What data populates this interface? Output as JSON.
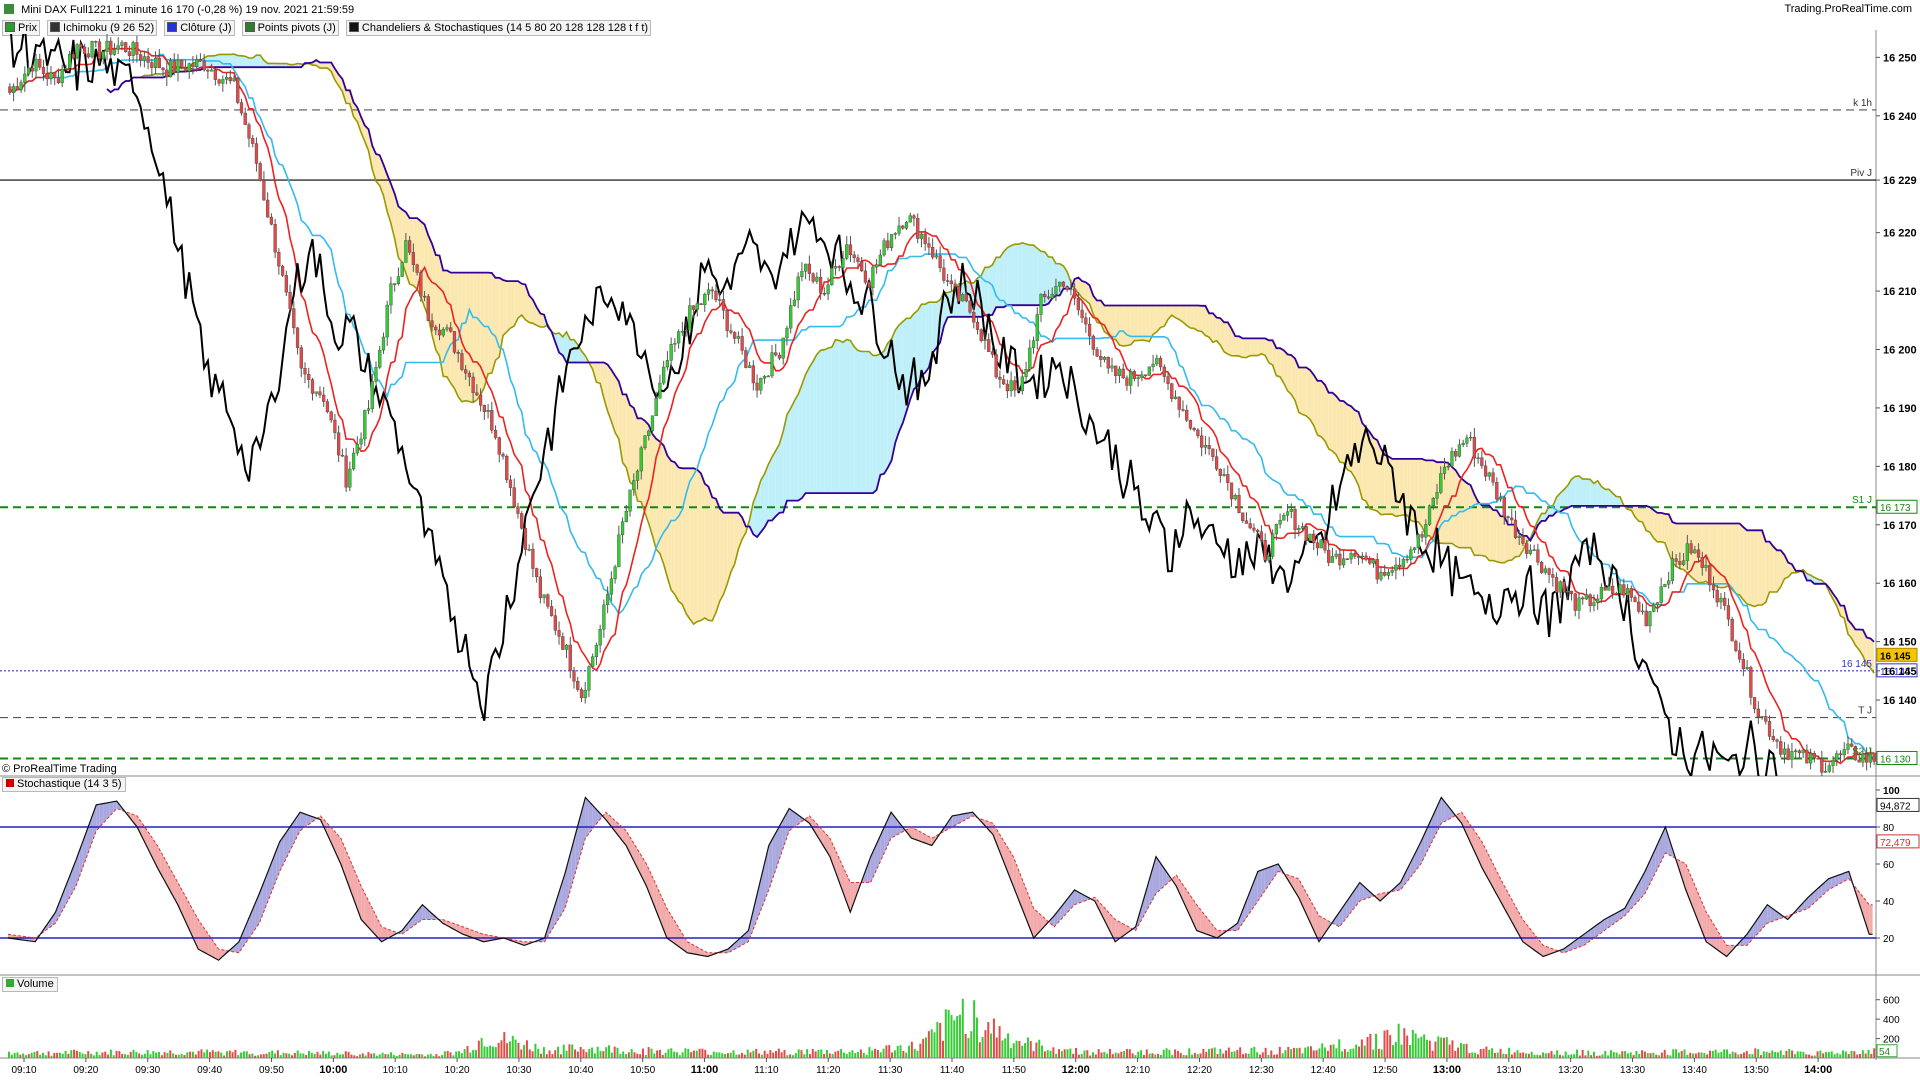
{
  "header": {
    "title": "Mini DAX Full1221 1 minute 16 170 (-0,28 %) 19 nov. 2021 21:59:59",
    "brand": "Trading.ProRealTime.com",
    "legend": [
      {
        "label": "Prix",
        "color": "#2e9b2e"
      },
      {
        "label": "Ichimoku (9 26 52)",
        "color": "#333333"
      },
      {
        "label": "Clôture (J)",
        "color": "#2233dd"
      },
      {
        "label": "Points pivots (J)",
        "color": "#2e7d32"
      },
      {
        "label": "Chandeliers & Stochastiques (14 5 80 20 128 128 128 t f t)",
        "color": "#111111"
      }
    ]
  },
  "panels": {
    "price_footer": "© ProRealTime Trading",
    "stochastic_label": "Stochastique (14 3 5)",
    "volume_label": "Volume"
  },
  "colors": {
    "up": "#33cc33",
    "down": "#e24a4a",
    "tenkan": "#ee2222",
    "kijun": "#33bbee",
    "span_a": "#999900",
    "span_b": "#330099",
    "cloud_bull": "#bfeff8",
    "cloud_bear": "#fbe8b0",
    "stoch_k": "#111111",
    "stoch_d": "#dd3333"
  },
  "chart_data": [
    {
      "type": "candlestick",
      "name": "Prix",
      "x_tick_labels": [
        "09:10",
        "09:20",
        "09:30",
        "09:40",
        "09:50",
        "10:00",
        "10:10",
        "10:20",
        "10:30",
        "10:40",
        "10:50",
        "11:00",
        "11:10",
        "11:20",
        "11:30",
        "11:40",
        "11:50",
        "12:00",
        "12:10",
        "12:20",
        "12:30",
        "12:40",
        "12:50",
        "13:00",
        "13:10",
        "13:20",
        "13:30",
        "13:40",
        "13:50",
        "14:00"
      ],
      "x_tick_bold": [
        "10:00",
        "11:00",
        "12:00",
        "13:00",
        "14:00"
      ],
      "ylim": [
        16127,
        16254
      ],
      "y_ticks": [
        16250,
        16240,
        16229,
        16220,
        16210,
        16200,
        16190,
        16180,
        16170,
        16160,
        16150,
        16145,
        16140
      ],
      "y_tick_labels": [
        "16 250",
        "16 240",
        "16 229",
        "16 220",
        "16 210",
        "16 200",
        "16 190",
        "16 180",
        "16 170",
        "16 160",
        "16 150",
        "16 145",
        "16 140"
      ],
      "close_anchors": [
        [
          0,
          16244
        ],
        [
          6,
          16249
        ],
        [
          12,
          16246
        ],
        [
          18,
          16252
        ],
        [
          24,
          16251
        ],
        [
          30,
          16252
        ],
        [
          36,
          16250
        ],
        [
          42,
          16248
        ],
        [
          52,
          16249
        ],
        [
          60,
          16245
        ],
        [
          66,
          16232
        ],
        [
          72,
          16215
        ],
        [
          78,
          16196
        ],
        [
          84,
          16192
        ],
        [
          90,
          16178
        ],
        [
          96,
          16190
        ],
        [
          102,
          16210
        ],
        [
          106,
          16218
        ],
        [
          112,
          16206
        ],
        [
          118,
          16202
        ],
        [
          124,
          16194
        ],
        [
          130,
          16186
        ],
        [
          136,
          16172
        ],
        [
          142,
          16158
        ],
        [
          148,
          16150
        ],
        [
          153,
          16141
        ],
        [
          158,
          16152
        ],
        [
          164,
          16170
        ],
        [
          170,
          16184
        ],
        [
          176,
          16198
        ],
        [
          182,
          16206
        ],
        [
          188,
          16210
        ],
        [
          194,
          16202
        ],
        [
          200,
          16194
        ],
        [
          206,
          16200
        ],
        [
          212,
          16214
        ],
        [
          218,
          16210
        ],
        [
          224,
          16218
        ],
        [
          230,
          16212
        ],
        [
          236,
          16220
        ],
        [
          240,
          16223
        ],
        [
          246,
          16218
        ],
        [
          252,
          16210
        ],
        [
          258,
          16206
        ],
        [
          264,
          16196
        ],
        [
          270,
          16192
        ],
        [
          276,
          16208
        ],
        [
          282,
          16212
        ],
        [
          288,
          16204
        ],
        [
          294,
          16196
        ],
        [
          300,
          16195
        ],
        [
          306,
          16198
        ],
        [
          312,
          16192
        ],
        [
          318,
          16185
        ],
        [
          324,
          16180
        ],
        [
          330,
          16172
        ],
        [
          336,
          16165
        ],
        [
          342,
          16172
        ],
        [
          348,
          16168
        ],
        [
          354,
          16164
        ],
        [
          360,
          16166
        ],
        [
          366,
          16162
        ],
        [
          372,
          16164
        ],
        [
          378,
          16168
        ],
        [
          384,
          16180
        ],
        [
          390,
          16185
        ],
        [
          396,
          16178
        ],
        [
          402,
          16170
        ],
        [
          408,
          16165
        ],
        [
          414,
          16160
        ],
        [
          420,
          16156
        ],
        [
          426,
          16158
        ],
        [
          432,
          16159
        ],
        [
          438,
          16154
        ],
        [
          444,
          16162
        ],
        [
          450,
          16166
        ],
        [
          456,
          16160
        ],
        [
          462,
          16150
        ],
        [
          468,
          16138
        ],
        [
          474,
          16132
        ],
        [
          480,
          16130
        ],
        [
          486,
          16129
        ],
        [
          492,
          16131
        ],
        [
          497,
          16130
        ]
      ],
      "price_lines": [
        {
          "value": 16241,
          "label": "k 1h",
          "style": "dash",
          "color": "#555555"
        },
        {
          "value": 16229,
          "label": "Piv J",
          "style": "solid",
          "color": "#000000"
        },
        {
          "value": 16173,
          "label": "S1 J",
          "style": "dash",
          "color": "#118811",
          "tag": "16 173"
        },
        {
          "value": 16145,
          "label": "16 145",
          "style": "dot",
          "color": "#3333cc",
          "tag": "16 145"
        },
        {
          "value": 16137,
          "label": "T J",
          "style": "dash",
          "color": "#555555"
        },
        {
          "value": 16130,
          "label": "S2 J",
          "style": "dash",
          "color": "#118811",
          "tag": "16 130"
        }
      ],
      "current_price_tag": "16 145"
    },
    {
      "type": "line",
      "name": "Stochastique (14 3 5)",
      "ylim": [
        0,
        100
      ],
      "levels": [
        80,
        20
      ],
      "y_ticks": [
        100,
        80,
        60,
        40,
        20
      ],
      "value_tags": [
        "94,872",
        "72,479"
      ],
      "k_anchors": [
        [
          0,
          20
        ],
        [
          8,
          18
        ],
        [
          14,
          34
        ],
        [
          20,
          62
        ],
        [
          26,
          92
        ],
        [
          32,
          94
        ],
        [
          38,
          80
        ],
        [
          44,
          58
        ],
        [
          50,
          38
        ],
        [
          56,
          14
        ],
        [
          62,
          8
        ],
        [
          68,
          18
        ],
        [
          74,
          44
        ],
        [
          80,
          72
        ],
        [
          86,
          88
        ],
        [
          92,
          84
        ],
        [
          98,
          60
        ],
        [
          104,
          30
        ],
        [
          110,
          18
        ],
        [
          116,
          24
        ],
        [
          122,
          38
        ],
        [
          128,
          28
        ],
        [
          134,
          22
        ],
        [
          140,
          18
        ],
        [
          146,
          20
        ],
        [
          152,
          16
        ],
        [
          158,
          20
        ],
        [
          164,
          55
        ],
        [
          170,
          96
        ],
        [
          176,
          84
        ],
        [
          182,
          70
        ],
        [
          188,
          48
        ],
        [
          194,
          20
        ],
        [
          200,
          12
        ],
        [
          206,
          10
        ],
        [
          212,
          14
        ],
        [
          218,
          24
        ],
        [
          224,
          70
        ],
        [
          230,
          90
        ],
        [
          236,
          82
        ],
        [
          242,
          64
        ],
        [
          248,
          34
        ],
        [
          254,
          64
        ],
        [
          260,
          88
        ],
        [
          266,
          74
        ],
        [
          272,
          70
        ],
        [
          278,
          86
        ],
        [
          284,
          88
        ],
        [
          290,
          76
        ],
        [
          296,
          48
        ],
        [
          302,
          20
        ],
        [
          308,
          32
        ],
        [
          314,
          46
        ],
        [
          320,
          40
        ],
        [
          326,
          18
        ],
        [
          332,
          26
        ],
        [
          338,
          64
        ],
        [
          344,
          48
        ],
        [
          350,
          24
        ],
        [
          356,
          20
        ],
        [
          362,
          28
        ],
        [
          368,
          56
        ],
        [
          374,
          60
        ],
        [
          380,
          42
        ],
        [
          386,
          18
        ],
        [
          392,
          34
        ],
        [
          398,
          50
        ],
        [
          404,
          40
        ],
        [
          410,
          50
        ],
        [
          416,
          72
        ],
        [
          422,
          96
        ],
        [
          428,
          82
        ],
        [
          434,
          58
        ],
        [
          440,
          38
        ],
        [
          446,
          18
        ],
        [
          452,
          10
        ],
        [
          458,
          14
        ],
        [
          464,
          22
        ],
        [
          470,
          30
        ],
        [
          476,
          36
        ],
        [
          482,
          56
        ],
        [
          488,
          80
        ],
        [
          494,
          46
        ],
        [
          500,
          18
        ],
        [
          506,
          10
        ],
        [
          512,
          22
        ],
        [
          518,
          38
        ],
        [
          524,
          30
        ],
        [
          530,
          42
        ],
        [
          536,
          52
        ],
        [
          542,
          56
        ],
        [
          548,
          22
        ]
      ],
      "d_anchors": [
        [
          0,
          22
        ],
        [
          8,
          20
        ],
        [
          14,
          28
        ],
        [
          20,
          48
        ],
        [
          26,
          78
        ],
        [
          32,
          90
        ],
        [
          38,
          86
        ],
        [
          44,
          70
        ],
        [
          50,
          50
        ],
        [
          56,
          30
        ],
        [
          62,
          14
        ],
        [
          68,
          12
        ],
        [
          74,
          28
        ],
        [
          80,
          56
        ],
        [
          86,
          78
        ],
        [
          92,
          86
        ],
        [
          98,
          74
        ],
        [
          104,
          48
        ],
        [
          110,
          26
        ],
        [
          116,
          22
        ],
        [
          122,
          30
        ],
        [
          128,
          30
        ],
        [
          134,
          26
        ],
        [
          140,
          22
        ],
        [
          146,
          20
        ],
        [
          152,
          18
        ],
        [
          158,
          18
        ],
        [
          164,
          36
        ],
        [
          170,
          74
        ],
        [
          176,
          88
        ],
        [
          182,
          78
        ],
        [
          188,
          60
        ],
        [
          194,
          36
        ],
        [
          200,
          18
        ],
        [
          206,
          12
        ],
        [
          212,
          12
        ],
        [
          218,
          18
        ],
        [
          224,
          46
        ],
        [
          230,
          78
        ],
        [
          236,
          86
        ],
        [
          242,
          74
        ],
        [
          248,
          50
        ],
        [
          254,
          50
        ],
        [
          260,
          74
        ],
        [
          266,
          80
        ],
        [
          272,
          74
        ],
        [
          278,
          80
        ],
        [
          284,
          86
        ],
        [
          290,
          82
        ],
        [
          296,
          64
        ],
        [
          302,
          36
        ],
        [
          308,
          26
        ],
        [
          314,
          38
        ],
        [
          320,
          42
        ],
        [
          326,
          30
        ],
        [
          332,
          24
        ],
        [
          338,
          44
        ],
        [
          344,
          54
        ],
        [
          350,
          38
        ],
        [
          356,
          24
        ],
        [
          362,
          24
        ],
        [
          368,
          40
        ],
        [
          374,
          56
        ],
        [
          380,
          52
        ],
        [
          386,
          32
        ],
        [
          392,
          26
        ],
        [
          398,
          40
        ],
        [
          404,
          44
        ],
        [
          410,
          46
        ],
        [
          416,
          60
        ],
        [
          422,
          82
        ],
        [
          428,
          88
        ],
        [
          434,
          72
        ],
        [
          440,
          50
        ],
        [
          446,
          30
        ],
        [
          452,
          16
        ],
        [
          458,
          12
        ],
        [
          464,
          16
        ],
        [
          470,
          24
        ],
        [
          476,
          32
        ],
        [
          482,
          44
        ],
        [
          488,
          66
        ],
        [
          494,
          60
        ],
        [
          500,
          34
        ],
        [
          506,
          16
        ],
        [
          512,
          16
        ],
        [
          518,
          28
        ],
        [
          524,
          32
        ],
        [
          530,
          36
        ],
        [
          536,
          46
        ],
        [
          542,
          52
        ],
        [
          548,
          38
        ]
      ]
    },
    {
      "type": "bar",
      "name": "Volume",
      "ylim": [
        0,
        700
      ],
      "y_ticks": [
        600,
        400,
        200
      ],
      "value_tag": "54",
      "volume_anchors": [
        [
          0,
          60
        ],
        [
          60,
          70
        ],
        [
          100,
          60
        ],
        [
          148,
          40
        ],
        [
          160,
          70
        ],
        [
          168,
          240
        ],
        [
          180,
          180
        ],
        [
          190,
          90
        ],
        [
          204,
          120
        ],
        [
          220,
          90
        ],
        [
          260,
          70
        ],
        [
          300,
          80
        ],
        [
          322,
          140
        ],
        [
          338,
          560
        ],
        [
          352,
          260
        ],
        [
          360,
          160
        ],
        [
          380,
          70
        ],
        [
          420,
          80
        ],
        [
          460,
          90
        ],
        [
          490,
          280
        ],
        [
          520,
          90
        ],
        [
          560,
          60
        ],
        [
          600,
          70
        ],
        [
          628,
          80
        ],
        [
          640,
          60
        ],
        [
          656,
          80
        ]
      ]
    }
  ]
}
